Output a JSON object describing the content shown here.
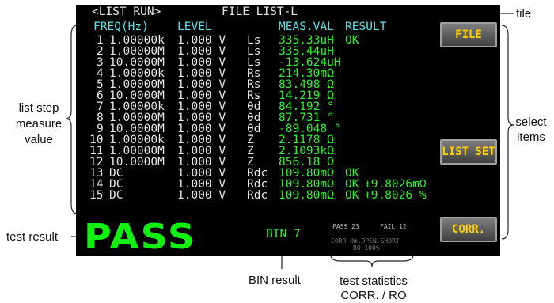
{
  "screen": {
    "header_left": "<LIST RUN>",
    "header_title": "FILE LIST-L",
    "columns": {
      "freq": "FREQ(Hz)",
      "level": "LEVEL",
      "meas": "MEAS.VAL",
      "result": "RESULT"
    },
    "rows": [
      {
        "n": "1",
        "freq": "1.00000k",
        "level": "1.000 V",
        "param": "Ls",
        "value": "335.33uH",
        "result": "OK",
        "dev": ""
      },
      {
        "n": "2",
        "freq": "1.00000M",
        "level": "1.000 V",
        "param": "Ls",
        "value": "335.44uH",
        "result": "",
        "dev": ""
      },
      {
        "n": "3",
        "freq": "10.0000M",
        "level": "1.000 V",
        "param": "Ls",
        "value": "-13.624uH",
        "result": "",
        "dev": ""
      },
      {
        "n": "4",
        "freq": "1.00000k",
        "level": "1.000 V",
        "param": "Rs",
        "value": "214.30mΩ",
        "result": "",
        "dev": ""
      },
      {
        "n": "5",
        "freq": "1.00000M",
        "level": "1.000 V",
        "param": "Rs",
        "value": "83.498 Ω",
        "result": "",
        "dev": ""
      },
      {
        "n": "6",
        "freq": "10.0000M",
        "level": "1.000 V",
        "param": "Rs",
        "value": "14.219 Ω",
        "result": "",
        "dev": ""
      },
      {
        "n": "7",
        "freq": "1.00000k",
        "level": "1.000 V",
        "param": "θd",
        "value": "84.192 °",
        "result": "",
        "dev": ""
      },
      {
        "n": "8",
        "freq": "1.00000M",
        "level": "1.000 V",
        "param": "θd",
        "value": "87.731 °",
        "result": "",
        "dev": ""
      },
      {
        "n": "9",
        "freq": "10.0000M",
        "level": "1.000 V",
        "param": "θd",
        "value": "-89.048 °",
        "result": "",
        "dev": ""
      },
      {
        "n": "10",
        "freq": "1.00000k",
        "level": "1.000 V",
        "param": "Z",
        "value": "2.1178 Ω",
        "result": "",
        "dev": ""
      },
      {
        "n": "11",
        "freq": "1.00000M",
        "level": "1.000 V",
        "param": "Z",
        "value": "2.1093kΩ",
        "result": "",
        "dev": ""
      },
      {
        "n": "12",
        "freq": "10.0000M",
        "level": "1.000 V",
        "param": "Z",
        "value": "856.18 Ω",
        "result": "",
        "dev": ""
      },
      {
        "n": "13",
        "freq": "DC",
        "level": "1.000 V",
        "param": "Rdc",
        "value": "109.80mΩ",
        "result": "OK",
        "dev": ""
      },
      {
        "n": "14",
        "freq": "DC",
        "level": "1.000 V",
        "param": "Rdc",
        "value": "109.80mΩ",
        "result": "OK",
        "dev": "+9.8026mΩ"
      },
      {
        "n": "15",
        "freq": "DC",
        "level": "1.000 V",
        "param": "Rdc",
        "value": "109.80mΩ",
        "result": "OK",
        "dev": "+9.8026 %"
      }
    ],
    "test_result": "PASS",
    "bin": "BIN 7",
    "stats": {
      "pass": "PASS 23",
      "fail": "FAIL 12",
      "corr": "CORR Om.OPEN.SHORT",
      "ro": "RO 100%"
    },
    "buttons": {
      "file": "FILE",
      "list_set": "LIST SET",
      "corr": "CORR."
    }
  },
  "annotations": {
    "file": "file",
    "list_step_line1": "list step",
    "list_step_line2": "measure",
    "list_step_line3": "value",
    "select_line1": "select",
    "select_line2": "items",
    "test_result": "test result",
    "bin_result": "BIN result",
    "stats_line1": "test statistics",
    "stats_line2": "CORR. / RO"
  },
  "colors": {
    "screen_bg": "#000000",
    "header_cyan": "#5fe0e8",
    "value_green": "#33ee33",
    "button_text": "#ffd100"
  }
}
